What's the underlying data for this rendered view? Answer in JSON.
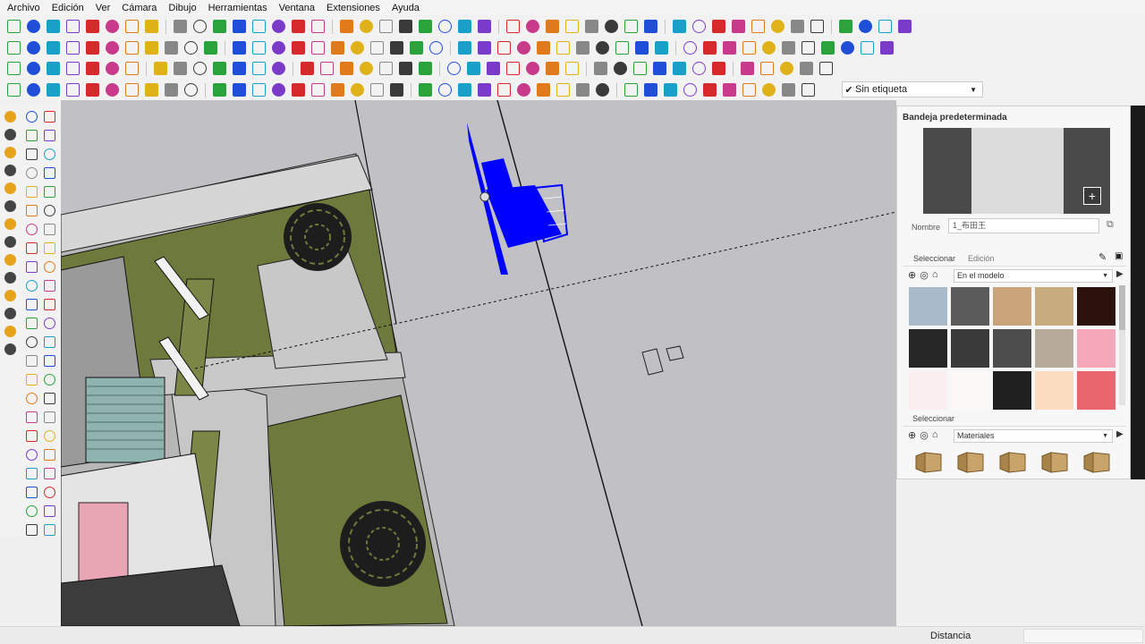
{
  "menubar": {
    "items": [
      "Archivo",
      "Edición",
      "Ver",
      "Cámara",
      "Dibujo",
      "Herramientas",
      "Ventana",
      "Extensiones",
      "Ayuda"
    ]
  },
  "toolbar": {
    "tag_dropdown": {
      "selected": "Sin etiqueta",
      "check": "✔"
    }
  },
  "tray": {
    "title": "Bandeja predeterminada",
    "add_material_label": "+",
    "name_label": "Nombre",
    "name_value": "1_布田王",
    "tabs": [
      "Seleccionar",
      "Edición"
    ],
    "library_select": "En el modelo",
    "secondary_select_label": "Seleccionar",
    "secondary_library": "Materiales",
    "swatch_colors": [
      "#a9bac8",
      "#5b5b5b",
      "#c9a47a",
      "#c8ab7f",
      "#2b120c",
      "#262626",
      "#3a3a3a",
      "#4d4d4d",
      "#b6ab99",
      "#f4a7b9",
      "#fbeef1",
      "#fbf8f6",
      "#1f1f1f",
      "#fbdcc0",
      "#e8666d"
    ]
  },
  "statusbar": {
    "measurement_label": "Distancia",
    "measurement_value": ""
  },
  "colors": {
    "viewport_bg": "#c1c1c5",
    "grass": "#6f7a3e",
    "selection_blue": "#0000ff",
    "menu_bg": "#f4f4f4"
  }
}
